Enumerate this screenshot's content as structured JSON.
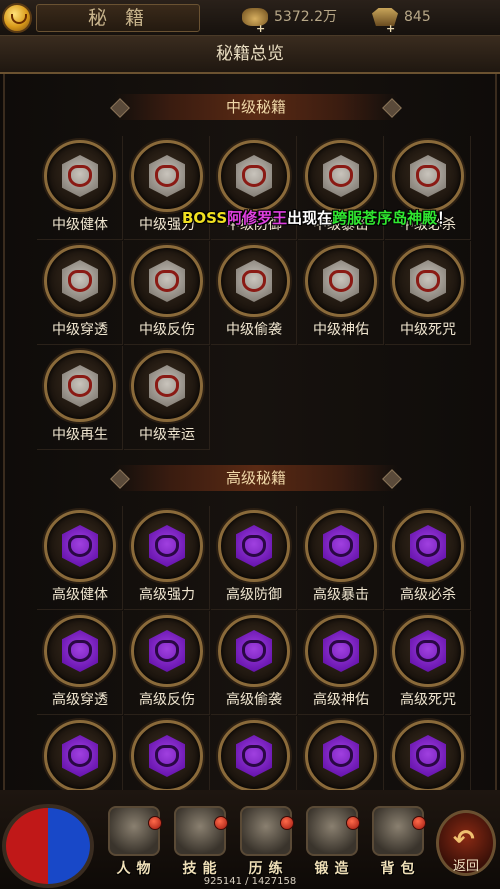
{
  "topbar": {
    "title": "秘籍",
    "gold": "5372.2万",
    "ingot": "845"
  },
  "header": {
    "title": "秘籍总览"
  },
  "sections": {
    "mid": {
      "title": "中级秘籍",
      "items": [
        "中级健体",
        "中级强力",
        "中级防御",
        "中级暴击",
        "中级必杀",
        "中级穿透",
        "中级反伤",
        "中级偷袭",
        "中级神佑",
        "中级死咒",
        "中级再生",
        "中级幸运"
      ]
    },
    "high": {
      "title": "高级秘籍",
      "items": [
        "高级健体",
        "高级强力",
        "高级防御",
        "高级暴击",
        "高级必杀",
        "高级穿透",
        "高级反伤",
        "高级偷袭",
        "高级神佑",
        "高级死咒",
        "",
        "",
        "",
        "",
        ""
      ]
    }
  },
  "announcement": {
    "boss": "BOSS",
    "name": "阿修罗王",
    "mid": "出现在",
    "place": "跨服苍序岛神殿",
    "end": "！"
  },
  "nav": {
    "items": [
      {
        "label": "人物",
        "icon": "warrior-helmet-icon"
      },
      {
        "label": "技能",
        "icon": "skill-book-icon"
      },
      {
        "label": "历练",
        "icon": "armor-icon"
      },
      {
        "label": "锻造",
        "icon": "anvil-icon"
      },
      {
        "label": "背包",
        "icon": "bag-icon"
      }
    ],
    "back": "返回",
    "exp": "925141 / 1427158"
  },
  "colors": {
    "accent": "#8a6a3a",
    "mid_gem": "#8a847c",
    "high_gem": "#6a16b0"
  }
}
